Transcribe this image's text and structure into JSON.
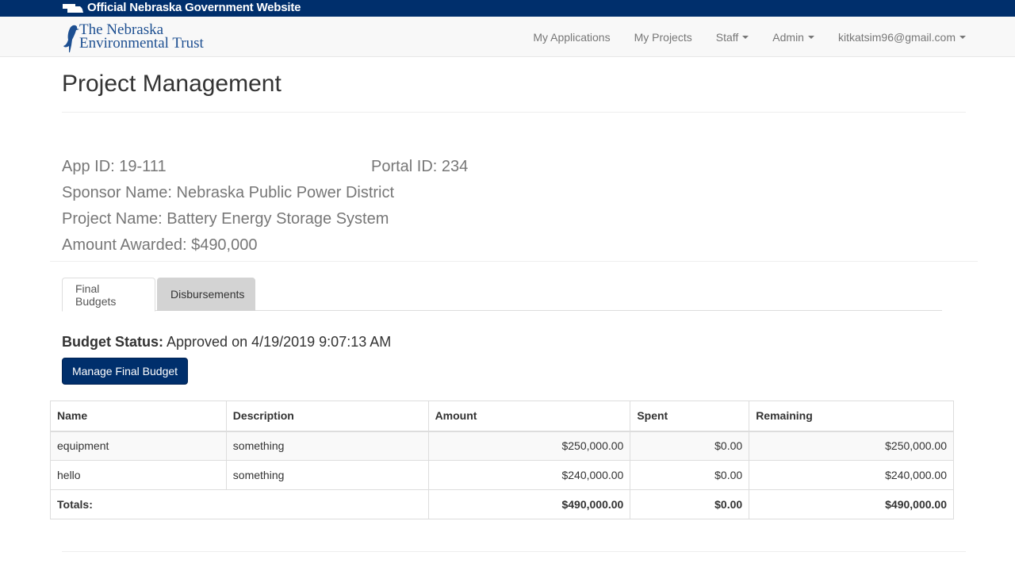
{
  "banner": {
    "text": "Official Nebraska Government Website",
    "icon": "nebraska-state-icon",
    "bg_color": "#002f6c"
  },
  "brand": {
    "line1": "The Nebraska",
    "line2": "Environmental Trust",
    "icon": "meadowlark-bird-icon",
    "color": "#1d4f91"
  },
  "nav": {
    "my_applications": "My Applications",
    "my_projects": "My Projects",
    "staff": "Staff",
    "admin": "Admin",
    "user": "kitkatsim96@gmail.com"
  },
  "page": {
    "title": "Project Management"
  },
  "project": {
    "app_id": "App ID: 19-111",
    "portal_id": "Portal ID: 234",
    "sponsor": "Sponsor Name: Nebraska Public Power District",
    "project_name": "Project Name: Battery Energy Storage System",
    "amount_awarded": "Amount Awarded: $490,000"
  },
  "tabs": {
    "final_budgets": "Final Budgets",
    "disbursements": "Disbursements",
    "active": "Final Budgets"
  },
  "budget": {
    "status_label": "Budget Status:",
    "status_value": "Approved on 4/19/2019 9:07:13 AM",
    "manage_button": "Manage Final Budget"
  },
  "table": {
    "headers": {
      "name": "Name",
      "description": "Description",
      "amount": "Amount",
      "spent": "Spent",
      "remaining": "Remaining"
    },
    "rows": [
      {
        "name": "equipment",
        "description": "something",
        "amount": "$250,000.00",
        "spent": "$0.00",
        "remaining": "$250,000.00"
      },
      {
        "name": "hello",
        "description": "something",
        "amount": "$240,000.00",
        "spent": "$0.00",
        "remaining": "$240,000.00"
      }
    ],
    "totals": {
      "label": "Totals:",
      "amount": "$490,000.00",
      "spent": "$0.00",
      "remaining": "$490,000.00"
    }
  }
}
